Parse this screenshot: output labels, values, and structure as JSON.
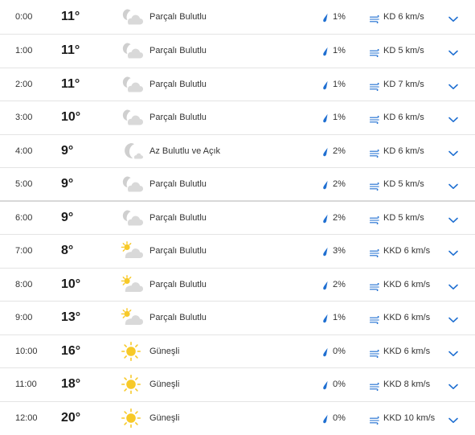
{
  "hourly": [
    {
      "time": "0:00",
      "temp": "11°",
      "icon": "partly-cloudy-night-icon",
      "condition": "Parçalı Bulutlu",
      "precip": "1%",
      "wind": "KD 6 km/s"
    },
    {
      "time": "1:00",
      "temp": "11°",
      "icon": "partly-cloudy-night-icon",
      "condition": "Parçalı Bulutlu",
      "precip": "1%",
      "wind": "KD 5 km/s"
    },
    {
      "time": "2:00",
      "temp": "11°",
      "icon": "partly-cloudy-night-icon",
      "condition": "Parçalı Bulutlu",
      "precip": "1%",
      "wind": "KD 7 km/s"
    },
    {
      "time": "3:00",
      "temp": "10°",
      "icon": "partly-cloudy-night-icon",
      "condition": "Parçalı Bulutlu",
      "precip": "1%",
      "wind": "KD 6 km/s"
    },
    {
      "time": "4:00",
      "temp": "9°",
      "icon": "mostly-clear-night-icon",
      "condition": "Az Bulutlu ve Açık",
      "precip": "2%",
      "wind": "KD 6 km/s"
    },
    {
      "time": "5:00",
      "temp": "9°",
      "icon": "partly-cloudy-night-icon",
      "condition": "Parçalı Bulutlu",
      "precip": "2%",
      "wind": "KD 5 km/s"
    },
    {
      "time": "6:00",
      "temp": "9°",
      "icon": "partly-cloudy-night-icon",
      "condition": "Parçalı Bulutlu",
      "precip": "2%",
      "wind": "KD 5 km/s"
    },
    {
      "time": "7:00",
      "temp": "8°",
      "icon": "partly-cloudy-day-icon",
      "condition": "Parçalı Bulutlu",
      "precip": "3%",
      "wind": "KKD 6 km/s"
    },
    {
      "time": "8:00",
      "temp": "10°",
      "icon": "partly-cloudy-day-icon",
      "condition": "Parçalı Bulutlu",
      "precip": "2%",
      "wind": "KKD 6 km/s"
    },
    {
      "time": "9:00",
      "temp": "13°",
      "icon": "partly-cloudy-day-icon",
      "condition": "Parçalı Bulutlu",
      "precip": "1%",
      "wind": "KKD 6 km/s"
    },
    {
      "time": "10:00",
      "temp": "16°",
      "icon": "sunny-icon",
      "condition": "Güneşli",
      "precip": "0%",
      "wind": "KKD 6 km/s"
    },
    {
      "time": "11:00",
      "temp": "18°",
      "icon": "sunny-icon",
      "condition": "Güneşli",
      "precip": "0%",
      "wind": "KKD 8 km/s"
    },
    {
      "time": "12:00",
      "temp": "20°",
      "icon": "sunny-icon",
      "condition": "Güneşli",
      "precip": "0%",
      "wind": "KKD 10 km/s"
    }
  ],
  "colors": {
    "accent": "#1f6fd1",
    "sun": "#f7c928",
    "cloud": "#d4d4d4",
    "moon": "#c9c9c9",
    "divider": "#e4e4e4"
  }
}
